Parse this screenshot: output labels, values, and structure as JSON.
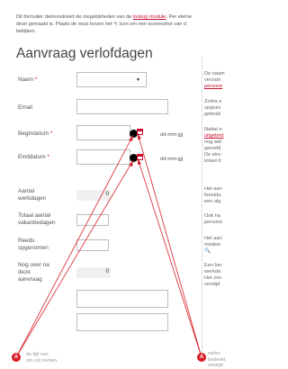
{
  "intro": {
    "line1_a": "Dit formulier demonstreert de mogelijkheden van de ",
    "line1_link": "lookup module",
    "line1_b": ". Per eleme",
    "line2": "deze gemaakt is. Plaats de muis boven het",
    "line2_b": " icon om een screenshot van d",
    "line3": "bekijken."
  },
  "title": "Aanvraag verlofdagen",
  "form": {
    "naam_label": "Naam",
    "email_label": "Email",
    "begindatum_label": "Begindatum",
    "einddatum_label": "Einddatum",
    "date_format": "dd-mm-jjjj",
    "required_mark": "*",
    "aantal_werkdagen_label_1": "Aantal",
    "aantal_werkdagen_label_2": "werkdagen",
    "aantal_werkdagen_value": "0",
    "totaal_label_1": "Totaal aantal",
    "totaal_label_2": "vakantiedagen",
    "reeds_label_1": "Reeds",
    "reeds_label_2": "opgenomen",
    "nog_over_label_1": "Nog over na",
    "nog_over_label_2": "deze",
    "nog_over_label_3": "aanvraag",
    "nog_over_value": "0"
  },
  "side": {
    "s1": [
      "De naam",
      "verzam",
      "persone"
    ],
    "s2": [
      "Zodra e",
      "opgezo",
      "gebruik"
    ],
    "s3": [
      "Nadat e",
      "uitgebrid",
      "nog wel",
      "gemeld",
      "De einc",
      "totaal d"
    ],
    "s4": [
      "Het aan",
      "feestda",
      "een alg"
    ],
    "s5": [
      "Ook ha",
      "persone"
    ],
    "s6": [
      "Het aan",
      "medew"
    ],
    "s7": [
      "Een ber",
      "werkda",
      "Het zon",
      "verwijd"
    ]
  },
  "markers": {
    "left_label": "A",
    "right_label": "A",
    "left_note": [
      "de tijd van",
      "om vrij nemen."
    ],
    "right_note": [
      "verbo",
      "bedenkt",
      "verwijd"
    ]
  },
  "colors": {
    "accent": "#c8102e",
    "arrow": "#d61f26"
  }
}
